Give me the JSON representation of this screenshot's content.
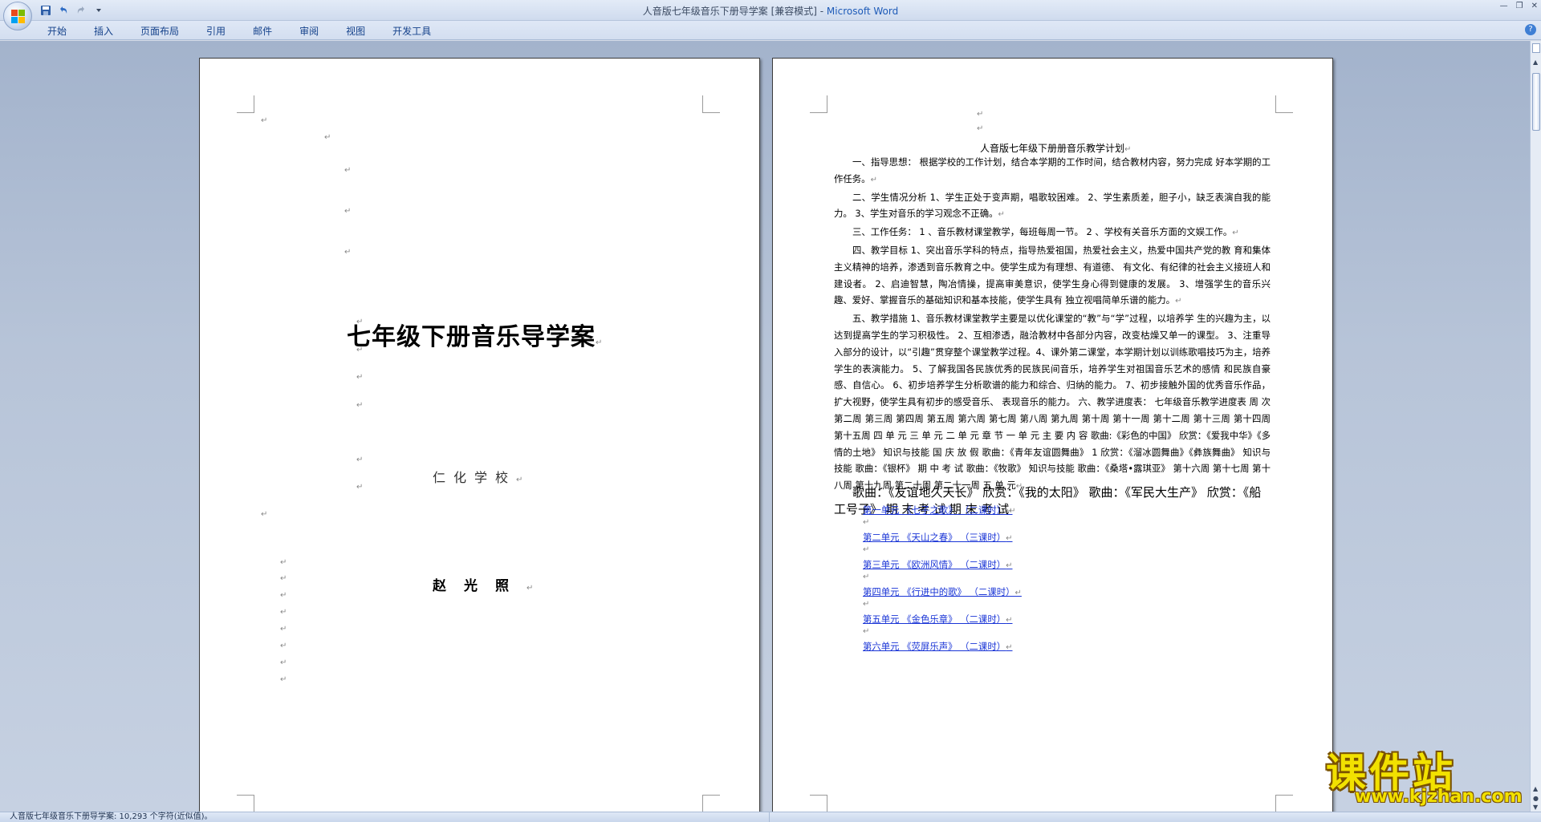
{
  "window": {
    "title": "人音版七年级音乐下册导学案 [兼容模式] - ",
    "app_name": "Microsoft Word"
  },
  "tabs": [
    "开始",
    "插入",
    "页面布局",
    "引用",
    "邮件",
    "审阅",
    "视图",
    "开发工具"
  ],
  "para_mark": "↵",
  "page1": {
    "title": "七年级下册音乐导学案",
    "school": "仁化学校",
    "author": "赵光照"
  },
  "page2": {
    "heading": "人音版七年级下册册音乐教学计划",
    "paragraphs": [
      "一、指导思想： 根据学校的工作计划，结合本学期的工作时间，结合教材内容，努力完成 好本学期的工作任务。",
      "二、学生情况分析 1、学生正处于变声期，唱歌较困难。 2、学生素质差，胆子小，缺乏表演自我的能力。 3、学生对音乐的学习观念不正确。",
      "三、工作任务： 1 、音乐教材课堂教学，每班每周一节。 2 、学校有关音乐方面的文娱工作。",
      "四、教学目标 1、突出音乐学科的特点，指导热爱祖国，热爱社会主义，热爱中国共产党的教 育和集体主义精神的培养，渗透到音乐教育之中。使学生成为有理想、有道德、 有文化、有纪律的社会主义接班人和建设者。 2、启迪智慧，陶冶情操，提高审美意识，使学生身心得到健康的发展。 3、增强学生的音乐兴趣、爱好、掌握音乐的基础知识和基本技能，使学生具有 独立视唱简单乐谱的能力。",
      "五、教学措施 1、音乐教材课堂教学主要是以优化课堂的“教”与“学”过程，以培养学 生的兴趣为主，以达到提高学生的学习积极性。 2、互相渗透，融洽教材中各部分内容，改变枯燥又单一的课型。 3、注重导入部分的设计，以“引趣”贯穿整个课堂教学过程。4、课外第二课堂，本学期计划以训练歌唱技巧为主，培养学生的表演能力。 5、了解我国各民族优秀的民族民间音乐，培养学生对祖国音乐艺术的感情 和民族自豪感、自信心。 6、初步培养学生分析歌谱的能力和综合、归纳的能力。 7、初步接触外国的优秀音乐作品，扩大视野，使学生具有初步的感受音乐、 表现音乐的能力。 六、教学进度表： 七年级音乐教学进度表 周 次 第二周 第三周 第四周 第五周 第六周 第七周 第八周 第九周 第十周 第十一周 第十二周 第十三周 第十四周 第十五周 四 单 元 三 单 元 二 单 元 章 节 一 单 元 主 要 内 容 歌曲:《彩色的中国》 欣赏：《爱我中华》《多情的土地》 知识与技能 国 庆 放 假 歌曲：《青年友谊圆舞曲》 1 欣赏：《溜冰圆舞曲》《彝族舞曲》 知识与技能 歌曲：《银杯》 期 中 考 试 歌曲：《牧歌》 知识与技能 歌曲：《桑塔•露琪亚》 第十六周 第十七周 第十八周 第十九周 第二十周 第二十一周 五 单 元"
    ],
    "big_paragraph": "歌曲：《友谊地久天长》 欣赏：《我的太阳》 歌曲：《军民大生产》 欣赏：《船工号子》 期 末 考 试 期 末 考 试",
    "toc": [
      "第一单元 《七子之歌》 （二课时）",
      "第二单元 《天山之春》 （三课时）",
      "第三单元 《欧洲风情》 （二课时）",
      "第四单元 《行进中的歌》 （二课时）",
      "第五单元 《金色乐章》 （二课时）",
      "第六单元 《荧屏乐声》 （二课时）"
    ]
  },
  "statusbar": {
    "text": "人音版七年级音乐下册导学案: 10,293 个字符(近似值)。"
  },
  "watermark": {
    "main": "课件站",
    "url": "www.kjzhan.com"
  }
}
